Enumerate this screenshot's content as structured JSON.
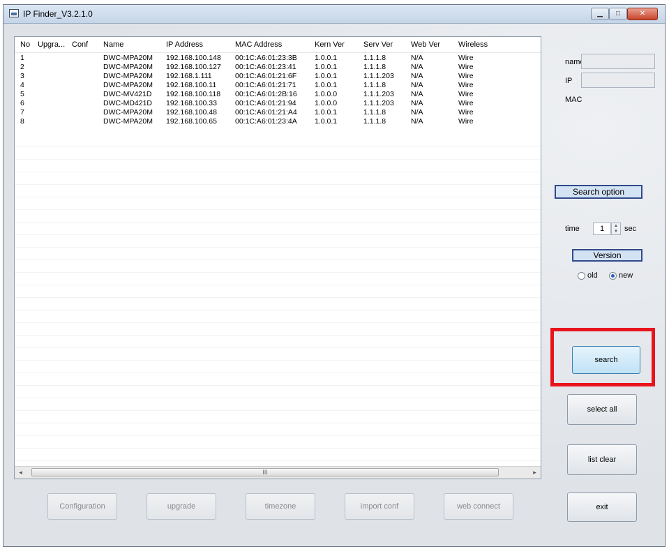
{
  "window": {
    "title": "IP Finder_V3.2.1.0",
    "min_glyph": "▁",
    "max_glyph": "□",
    "close_glyph": "✕"
  },
  "list": {
    "columns": [
      "No",
      "Upgra...",
      "Conf",
      "Name",
      "IP Address",
      "MAC Address",
      "Kern Ver",
      "Serv Ver",
      "Web Ver",
      "Wireless"
    ],
    "rows": [
      [
        "1",
        "",
        "",
        "DWC-MPA20M",
        "192.168.100.148",
        "00:1C:A6:01:23:3B",
        "1.0.0.1",
        "1.1.1.8",
        "N/A",
        "Wire"
      ],
      [
        "2",
        "",
        "",
        "DWC-MPA20M",
        "192.168.100.127",
        "00:1C:A6:01:23:41",
        "1.0.0.1",
        "1.1.1.8",
        "N/A",
        "Wire"
      ],
      [
        "3",
        "",
        "",
        "DWC-MPA20M",
        "192.168.1.111",
        "00:1C:A6:01:21:6F",
        "1.0.0.1",
        "1.1.1.203",
        "N/A",
        "Wire"
      ],
      [
        "4",
        "",
        "",
        "DWC-MPA20M",
        "192.168.100.11",
        "00:1C:A6:01:21:71",
        "1.0.0.1",
        "1.1.1.8",
        "N/A",
        "Wire"
      ],
      [
        "5",
        "",
        "",
        "DWC-MV421D",
        "192.168.100.118",
        "00:1C:A6:01:2B:16",
        "1.0.0.0",
        "1.1.1.203",
        "N/A",
        "Wire"
      ],
      [
        "6",
        "",
        "",
        "DWC-MD421D",
        "192.168.100.33",
        "00:1C:A6:01:21:94",
        "1.0.0.0",
        "1.1.1.203",
        "N/A",
        "Wire"
      ],
      [
        "7",
        "",
        "",
        "DWC-MPA20M",
        "192.168.100.48",
        "00:1C:A6:01:21:A4",
        "1.0.0.1",
        "1.1.1.8",
        "N/A",
        "Wire"
      ],
      [
        "8",
        "",
        "",
        "DWC-MPA20M",
        "192.168.100.65",
        "00:1C:A6:01:23:4A",
        "1.0.0.1",
        "1.1.1.8",
        "N/A",
        "Wire"
      ]
    ],
    "scroll_left": "◂",
    "scroll_right": "▸",
    "scroll_thumb": "III"
  },
  "bottom_buttons": {
    "configuration": "Configuration",
    "upgrade": "upgrade",
    "timezone": "timezone",
    "import_conf": "import conf",
    "web_connect": "web connect"
  },
  "info": {
    "name_label": "name",
    "ip_label": "IP",
    "mac_label": "MAC",
    "name_value": "",
    "ip_value": ""
  },
  "search_option": {
    "header": "Search option",
    "time_label": "time",
    "time_value": "1",
    "time_unit": "sec",
    "version_header": "Version",
    "version_old": "old",
    "version_new": "new",
    "selected_version": "new"
  },
  "right_buttons": {
    "search": "search",
    "select_all": "select all",
    "list_clear": "list clear",
    "exit": "exit"
  },
  "colors": {
    "highlight": "#e8141c",
    "group_border": "#314a8c"
  }
}
